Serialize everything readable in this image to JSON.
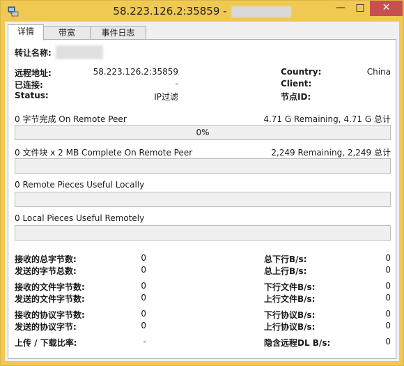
{
  "window": {
    "title": "58.223.126.2:35859 -",
    "controls": {
      "minimize": "—",
      "maximize": "□",
      "close": "✕"
    },
    "colors": {
      "titlebar": "#f0c953",
      "close": "#c7504f",
      "progress": "#06b025"
    }
  },
  "tabs": [
    "详情",
    "带宽",
    "事件日志"
  ],
  "active_tab": 0,
  "details": {
    "transfer_name_label": "转让名称:",
    "remote_addr_label": "远程地址:",
    "remote_addr": "58.223.126.2:35859",
    "connected_label": "已连接:",
    "connected": "-",
    "status_label": "Status:",
    "status": "IP过滤",
    "country_label": "Country:",
    "country": "China",
    "client_label": "Client:",
    "client": "",
    "node_id_label": "节点ID:",
    "node_id": ""
  },
  "progress": [
    {
      "left": "0 字节完成 On Remote Peer",
      "right": "4.71 G Remaining,  4.71 G 总计",
      "bar_text": "0%",
      "fraction": 0
    },
    {
      "left": "0 文件块  x  2 MB Complete On Remote Peer",
      "right": "2,249 Remaining,  2,249 总计",
      "bar_text": "",
      "fraction": 0
    },
    {
      "left": "0 Remote Pieces Useful Locally",
      "right": "",
      "bar_text": "",
      "fraction": 0
    },
    {
      "left": "0 Local Pieces Useful Remotely",
      "right": "",
      "bar_text": "",
      "fraction": 0
    }
  ],
  "stats": [
    {
      "l_label": "接收的总字节数:",
      "l_val": "0",
      "r_label": "总下行B/s:",
      "r_val": "0"
    },
    {
      "l_label": "发送的字节总数:",
      "l_val": "0",
      "r_label": "总上行B/s:",
      "r_val": "0"
    },
    {
      "l_label": "接收的文件字节数:",
      "l_val": "0",
      "r_label": "下行文件B/s:",
      "r_val": "0"
    },
    {
      "l_label": "发送的文件字节数:",
      "l_val": "0",
      "r_label": "上行文件B/s:",
      "r_val": "0"
    },
    {
      "l_label": "接收的协议字节数:",
      "l_val": "0",
      "r_label": "下行协议B/s:",
      "r_val": "0"
    },
    {
      "l_label": "发送的协议字节:",
      "l_val": "0",
      "r_label": "上行协议B/s:",
      "r_val": "0"
    },
    {
      "l_label": "上传 / 下载比率:",
      "l_val": "-",
      "r_label": "隐含远程DL B/s:",
      "r_val": "0"
    }
  ]
}
